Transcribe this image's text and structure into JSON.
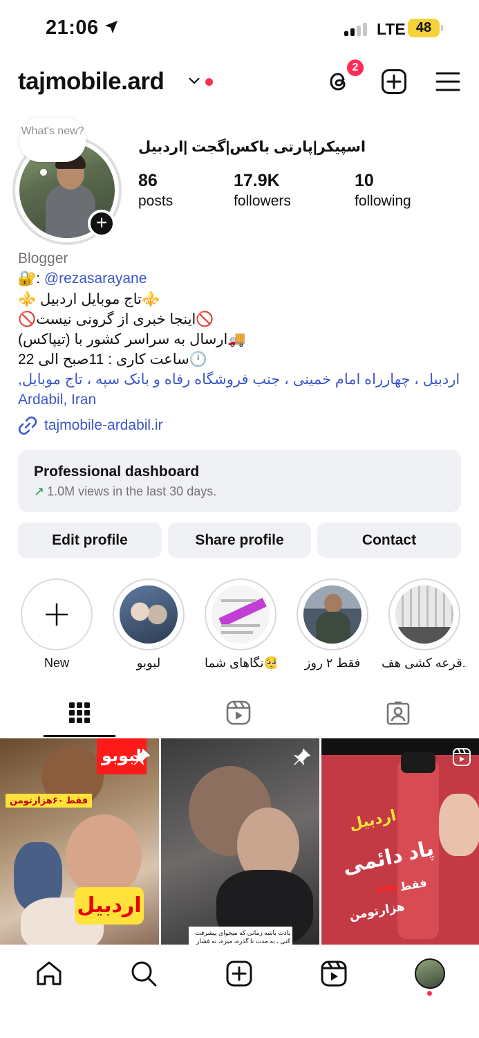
{
  "status_bar": {
    "time": "21:06",
    "network": "LTE",
    "battery": "48"
  },
  "header": {
    "username": "tajmobile.ard",
    "threads_badge": "2"
  },
  "profile": {
    "bubble_text": "What's new?",
    "full_name": "اسپیکر|پارتی باکس|گجت |اردبیل",
    "stats": [
      {
        "value": "86",
        "label": "posts"
      },
      {
        "value": "17.9K",
        "label": "followers"
      },
      {
        "value": "10",
        "label": "following"
      }
    ]
  },
  "bio": {
    "category": "Blogger",
    "line1_prefix": "🔐: ",
    "line1_mention": "@rezasarayane",
    "line2": "⚜️تاج موبایل اردبیل ⚜️",
    "line3": "🚫اینجا خبری از گرونی نیست🚫",
    "line4": "🚚ارسال به سراسر کشور با (تیپاکس)",
    "line5": "🕛ساعت کاری : 11صبح الی 22",
    "address_line1": "اردبیل ، چهارراه امام خمینی ، جنب فروشگاه رفاه و بانک سپه ، تاج موبایل,",
    "address_line2": "Ardabil, Iran",
    "website": "tajmobile-ardabil.ir"
  },
  "dashboard": {
    "title": "Professional dashboard",
    "subtitle": "1.0M views in the last 30 days."
  },
  "buttons": {
    "edit": "Edit profile",
    "share": "Share profile",
    "contact": "Contact"
  },
  "highlights": [
    {
      "label": "New"
    },
    {
      "label": "لبوبو"
    },
    {
      "label": "نگاهای شما🥺"
    },
    {
      "label": "فقط ۲ روز"
    },
    {
      "label": "قرعه کشی هف..."
    }
  ],
  "posts": [
    {
      "overlay_top": "لبوبو",
      "overlay_price": "فقط ۶۰هزارتومن",
      "overlay_city": "اردبیل"
    },
    {
      "caption": "یادت باشه زمانی که میخوای پیشرفت کنی ، به مدت تا گذره، میره، ته فشار اما صبر داشته باش"
    },
    {
      "overlay_city": "اردبیل",
      "overlay_title": "پاد دائمی",
      "overlay_price_prefix": "فقط",
      "overlay_price_num": "۳۹۹",
      "overlay_price_unit": "هزارتومن"
    }
  ],
  "colors": {
    "accent_link": "#3b56c9",
    "notification": "#ff2d55",
    "button_bg": "#eff1f4"
  }
}
